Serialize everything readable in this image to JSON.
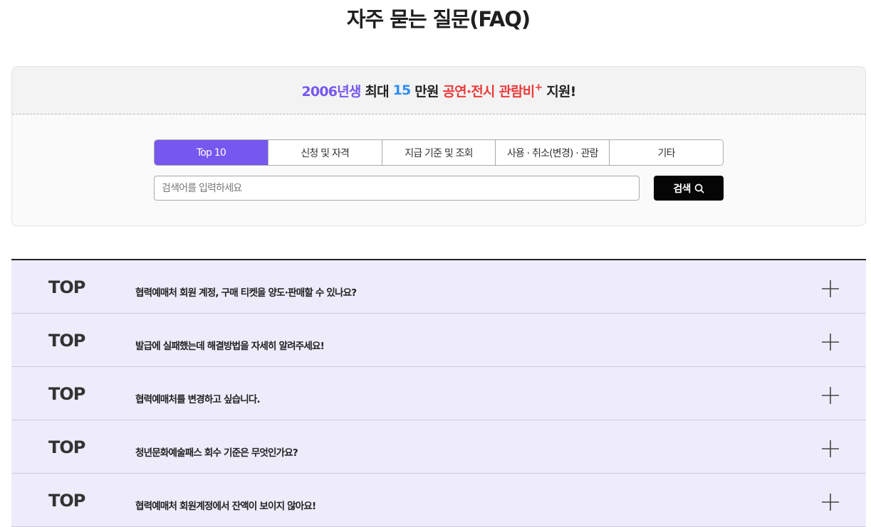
{
  "page": {
    "title": "자주 묻는 질문(FAQ)"
  },
  "banner": {
    "year": "2006년생",
    "text_max": "최대",
    "amount": "15",
    "unit": "만원",
    "category": "공연·전시 관람비",
    "plus": "+",
    "support": "지원!",
    "colors": {
      "purple": "#7657f0",
      "blue": "#2f8df0",
      "red": "#ec3c3c"
    }
  },
  "tabs": [
    {
      "label": "Top 10",
      "active": true
    },
    {
      "label": "신청 및 자격",
      "active": false
    },
    {
      "label": "지급 기준 및 조회",
      "active": false
    },
    {
      "label": "사용 · 취소(변경) · 관람",
      "active": false
    },
    {
      "label": "기타",
      "active": false
    }
  ],
  "search": {
    "placeholder": "검색어를 입력하세요",
    "value": "",
    "button_label": "검색",
    "icon": "search-icon"
  },
  "faq": [
    {
      "tag": "TOP",
      "question": "협력예매처 회원 계정, 구매 티켓을 양도·판매할 수 있나요?",
      "icon": "plus-icon"
    },
    {
      "tag": "TOP",
      "question": "발급에 실패했는데 해결방법을 자세히 알려주세요!",
      "icon": "plus-icon"
    },
    {
      "tag": "TOP",
      "question": "협력예매처를 변경하고 싶습니다.",
      "icon": "plus-icon"
    },
    {
      "tag": "TOP",
      "question": "청년문화예술패스 회수 기준은 무엇인가요?",
      "icon": "plus-icon"
    },
    {
      "tag": "TOP",
      "question": "협력예매처 회원계정에서 잔액이 보이지 않아요!",
      "icon": "plus-icon"
    }
  ],
  "colors": {
    "accent": "#7657f0",
    "faq_row_bg": "#eeebfb",
    "button_bg": "#050505"
  }
}
